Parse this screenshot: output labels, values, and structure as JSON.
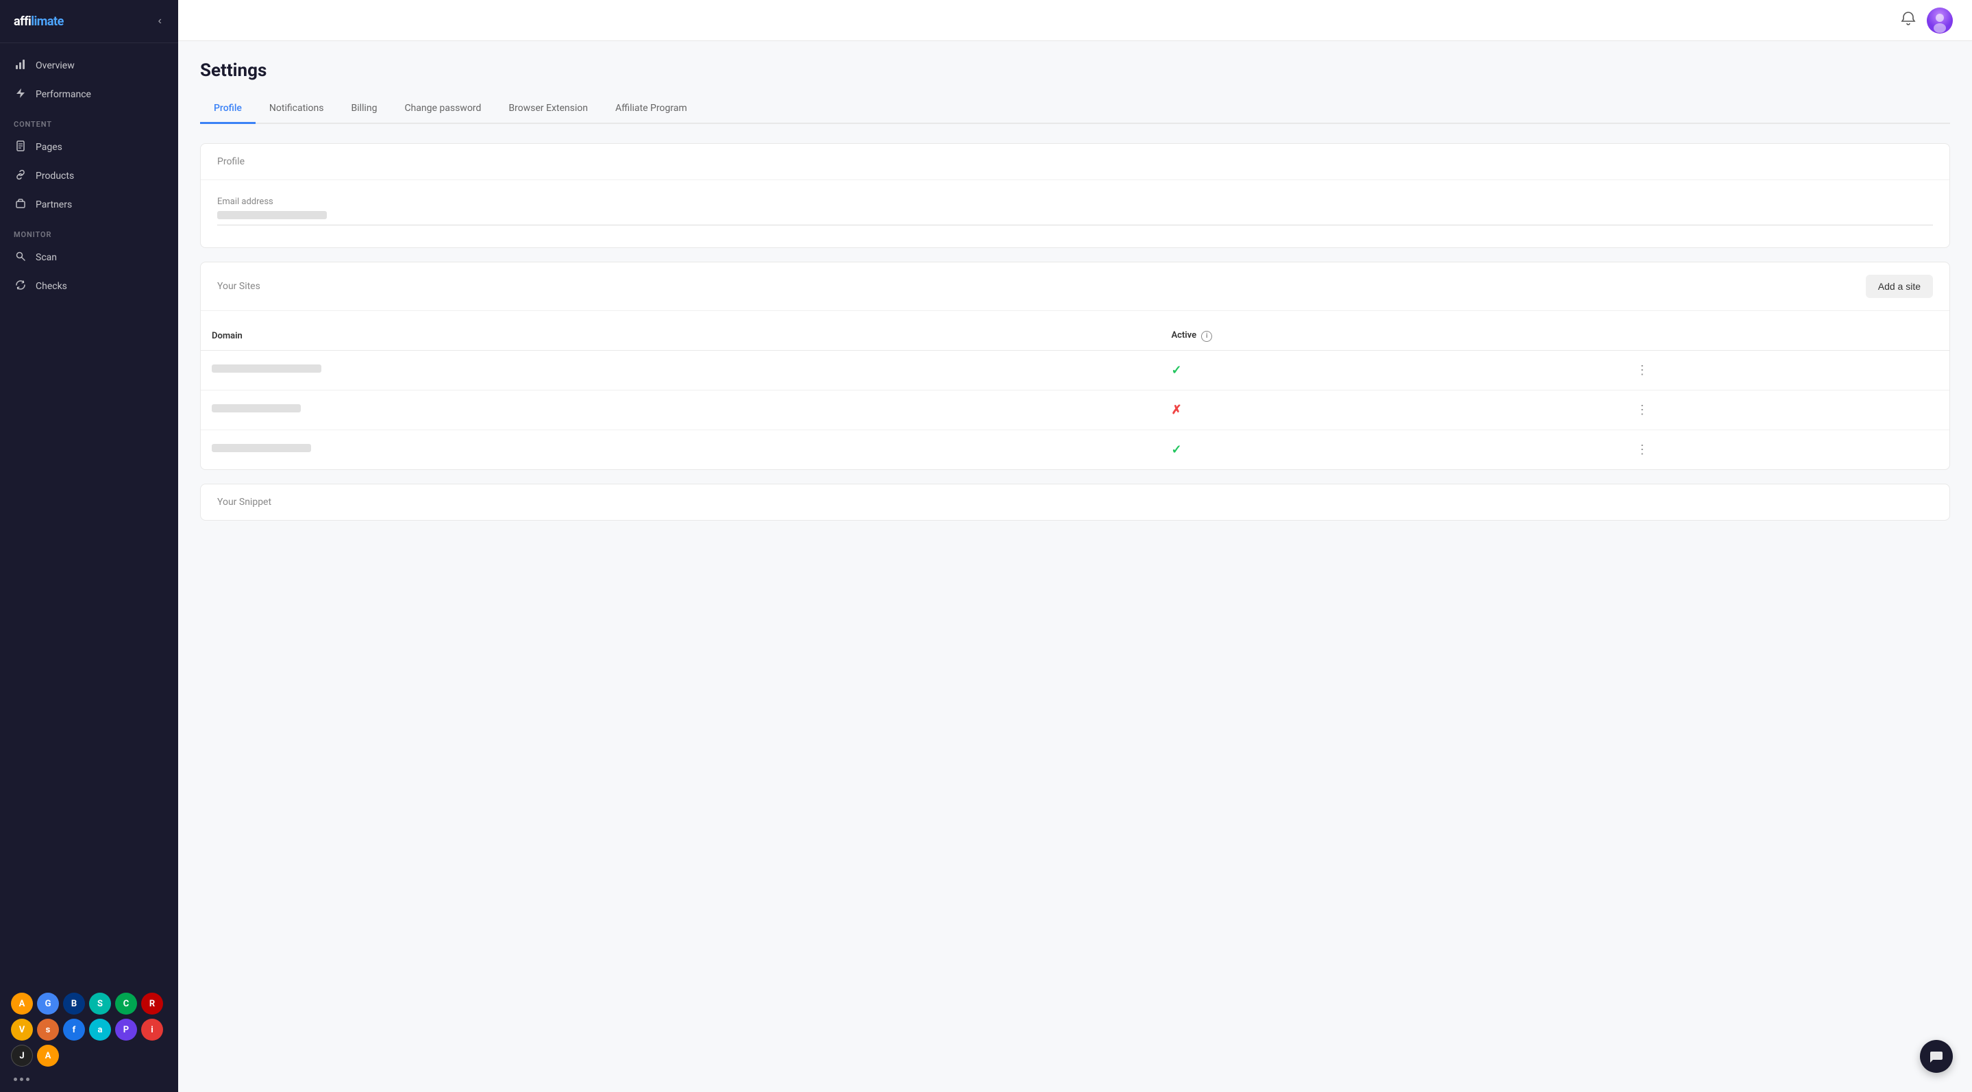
{
  "app": {
    "logo": "affilimate",
    "logo_highlight": "affi",
    "logo_rest": "limate"
  },
  "sidebar": {
    "nav_items": [
      {
        "id": "overview",
        "label": "Overview",
        "icon": "chart"
      },
      {
        "id": "performance",
        "label": "Performance",
        "icon": "bolt"
      }
    ],
    "content_section": "CONTENT",
    "content_items": [
      {
        "id": "pages",
        "label": "Pages",
        "icon": "doc"
      },
      {
        "id": "products",
        "label": "Products",
        "icon": "link"
      },
      {
        "id": "partners",
        "label": "Partners",
        "icon": "briefcase"
      }
    ],
    "monitor_section": "MONITOR",
    "monitor_items": [
      {
        "id": "scan",
        "label": "Scan",
        "icon": "search"
      },
      {
        "id": "checks",
        "label": "Checks",
        "icon": "refresh"
      }
    ],
    "integrations": [
      {
        "id": "amazon",
        "label": "A",
        "color": "#ff9900"
      },
      {
        "id": "google",
        "label": "G",
        "color": "#4285f4"
      },
      {
        "id": "booking",
        "label": "B",
        "color": "#003580"
      },
      {
        "id": "skimlinks",
        "label": "S",
        "color": "#00b8a9"
      },
      {
        "id": "cj",
        "label": "C",
        "color": "#00a651"
      },
      {
        "id": "rakuten",
        "label": "R",
        "color": "#bf0000"
      },
      {
        "id": "viglink",
        "label": "V",
        "color": "#f4a800"
      },
      {
        "id": "shareasale",
        "label": "s",
        "color": "#e06b2e"
      },
      {
        "id": "flexoffers",
        "label": "f",
        "color": "#1a73e8"
      },
      {
        "id": "awin",
        "label": "a",
        "color": "#00bcd4"
      },
      {
        "id": "partnerize",
        "label": "P",
        "color": "#6a3de8"
      },
      {
        "id": "impact",
        "label": "i",
        "color": "#e53935"
      },
      {
        "id": "jrs",
        "label": "J",
        "color": "#212121"
      },
      {
        "id": "amazon2",
        "label": "A",
        "color": "#ff9900"
      }
    ],
    "more_label": "..."
  },
  "topbar": {
    "bell_label": "Notifications",
    "avatar_label": "User avatar"
  },
  "settings": {
    "page_title": "Settings",
    "tabs": [
      {
        "id": "profile",
        "label": "Profile",
        "active": true
      },
      {
        "id": "notifications",
        "label": "Notifications",
        "active": false
      },
      {
        "id": "billing",
        "label": "Billing",
        "active": false
      },
      {
        "id": "change-password",
        "label": "Change password",
        "active": false
      },
      {
        "id": "browser-extension",
        "label": "Browser Extension",
        "active": false
      },
      {
        "id": "affiliate-program",
        "label": "Affiliate Program",
        "active": false
      }
    ],
    "profile_section": {
      "title": "Profile",
      "email_label": "Email address",
      "email_value": ""
    },
    "sites_section": {
      "title": "Your Sites",
      "add_button": "Add a site",
      "domain_col": "Domain",
      "active_col": "Active",
      "rows": [
        {
          "id": 1,
          "domain_width": 160,
          "active": true
        },
        {
          "id": 2,
          "domain_width": 130,
          "active": false
        },
        {
          "id": 3,
          "domain_width": 145,
          "active": true
        }
      ]
    },
    "snippet_section": {
      "title": "Your Snippet"
    }
  },
  "chat": {
    "icon": "💬"
  }
}
